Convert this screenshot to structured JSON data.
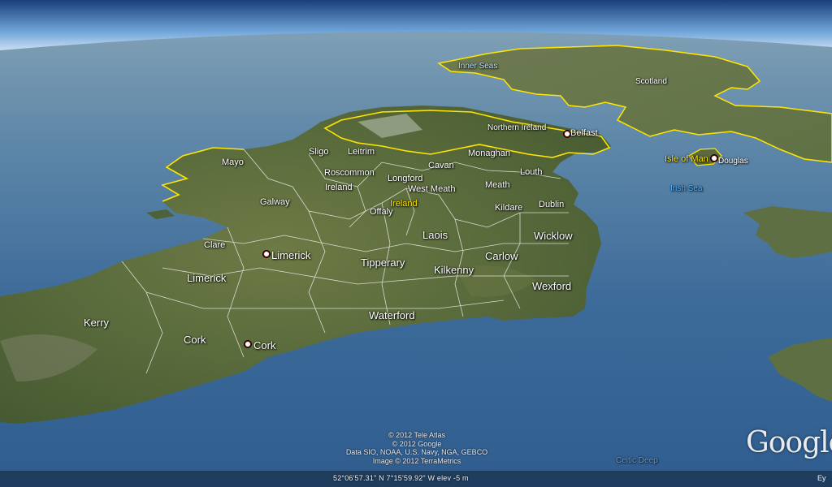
{
  "labels": {
    "inner_seas": "Inner Seas",
    "scotland": "Scotland",
    "northern_ireland": "Northern Ireland",
    "belfast": "Belfast",
    "sligo": "Sligo",
    "leitrim": "Leitrim",
    "monaghan": "Monaghan",
    "mayo": "Mayo",
    "roscommon": "Roscommon",
    "cavan": "Cavan",
    "louth": "Louth",
    "longford": "Longford",
    "ireland_region": "Ireland",
    "west_meath": "West Meath",
    "meath": "Meath",
    "galway": "Galway",
    "ireland_country": "Ireland",
    "offaly": "Offaly",
    "kildare": "Kildare",
    "dublin": "Dublin",
    "isle_of_man": "Isle of Man",
    "douglas": "Douglas",
    "irish_sea": "Irish Sea",
    "laois": "Laois",
    "wicklow": "Wicklow",
    "clare": "Clare",
    "limerick_city": "Limerick",
    "carlow": "Carlow",
    "tipperary": "Tipperary",
    "kilkenny": "Kilkenny",
    "limerick_county": "Limerick",
    "wexford": "Wexford",
    "kerry": "Kerry",
    "waterford": "Waterford",
    "cork_county": "Cork",
    "cork_city": "Cork",
    "celtic_deep": "Celtic Deep"
  },
  "attribution": [
    "© 2012 Tele Atlas",
    "© 2012 Google",
    "Data SIO, NOAA, U.S. Navy, NGA, GEBCO",
    "Image © 2012 TerraMetrics"
  ],
  "status": {
    "coordinates": "52°06'57.31\" N   7°15'59.92\" W  elev   -5 m",
    "eye_alt": "Ey"
  },
  "logo": "Google",
  "colors": {
    "ocean": "#3f6f9c",
    "land": "#5a6b3e",
    "border_yellow": "#ffe600",
    "sky": "#ffffff"
  },
  "icons": {
    "city_marker": "city-dot-icon"
  }
}
